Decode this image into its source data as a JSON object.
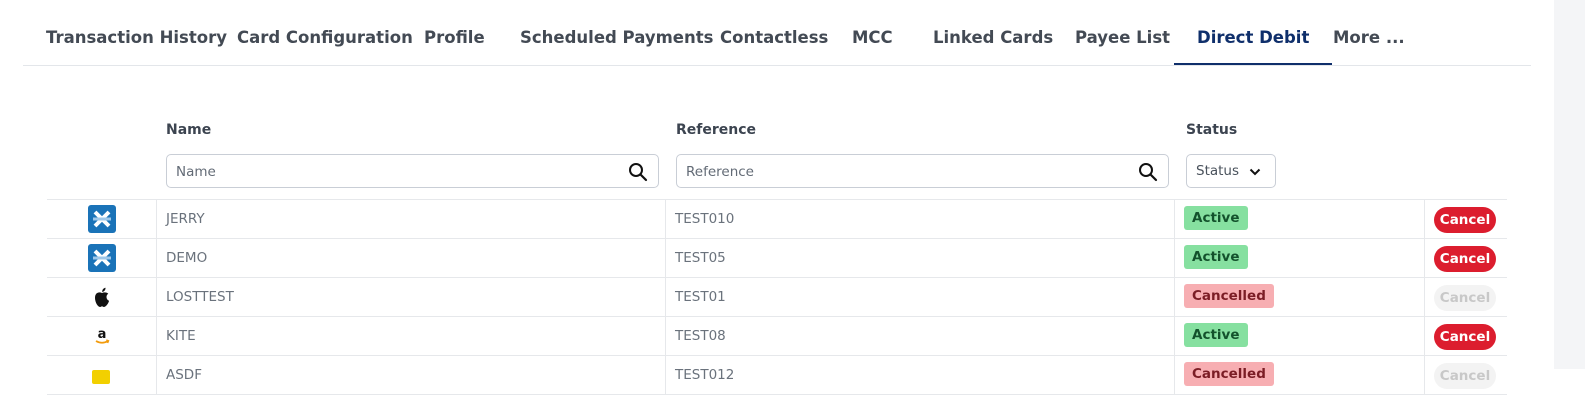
{
  "tabs": [
    {
      "label": "Transaction History"
    },
    {
      "label": "Card Configuration"
    },
    {
      "label": "Profile"
    },
    {
      "label": "Scheduled Payments"
    },
    {
      "label": "Contactless"
    },
    {
      "label": "MCC"
    },
    {
      "label": "Linked Cards"
    },
    {
      "label": "Payee List"
    },
    {
      "label": "Direct Debit",
      "active": true
    },
    {
      "label": "More ..."
    }
  ],
  "columns": {
    "name": {
      "label": "Name",
      "placeholder": "Name"
    },
    "reference": {
      "label": "Reference",
      "placeholder": "Reference"
    },
    "status": {
      "label": "Status",
      "selected": "Status"
    }
  },
  "rows": [
    {
      "logo": "blue-merchant-logo",
      "name": "JERRY",
      "reference": "TEST010",
      "status": "Active",
      "action": "Cancel",
      "action_enabled": true
    },
    {
      "logo": "blue-merchant-logo",
      "name": "DEMO",
      "reference": "TEST05",
      "status": "Active",
      "action": "Cancel",
      "action_enabled": true
    },
    {
      "logo": "apple-logo",
      "name": "LOSTTEST",
      "reference": "TEST01",
      "status": "Cancelled",
      "action": "Cancel",
      "action_enabled": false
    },
    {
      "logo": "amazon-logo",
      "name": "KITE",
      "reference": "TEST08",
      "status": "Active",
      "action": "Cancel",
      "action_enabled": true
    },
    {
      "logo": "yellow-merchant-logo",
      "name": "ASDF",
      "reference": "TEST012",
      "status": "Cancelled",
      "action": "Cancel",
      "action_enabled": false
    }
  ],
  "colors": {
    "active_tab": "#0f2f6b",
    "cancel_button": "#dc1d2e",
    "status_active_bg": "#86e0a0",
    "status_cancelled_bg": "#f7aeb2"
  }
}
